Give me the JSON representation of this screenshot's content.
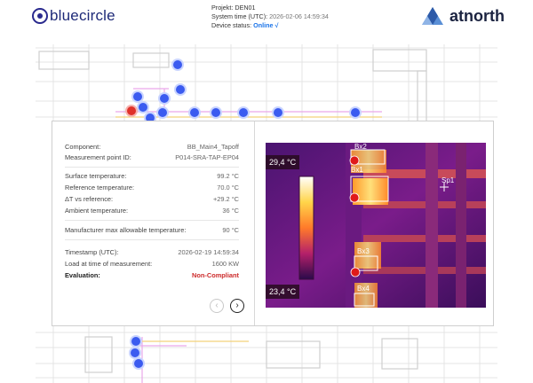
{
  "header": {
    "brand_left": "bluecircle",
    "project_label": "Projekt:",
    "project_value": "DEN01",
    "system_time_label": "System time (UTC):",
    "system_time_value": "2026-02-06 14:59:34",
    "device_status_label": "Device status:",
    "device_status_value": "Online √",
    "brand_right": "atnorth"
  },
  "popup": {
    "rows": [
      {
        "label": "Component:",
        "value": "BB_Main4_Tapoff"
      },
      {
        "label": "Measurement point ID:",
        "value": "P014-SRA-TAP-EP04"
      },
      {
        "label": "Surface temperature:",
        "value": "99.2 °C"
      },
      {
        "label": "Reference temperature:",
        "value": "70.0 °C"
      },
      {
        "label": "ΔT vs reference:",
        "value": "+29.2 °C"
      },
      {
        "label": "Ambient temperature:",
        "value": "36 °C"
      },
      {
        "label": "Manufacturer max allowable temperature:",
        "value": "90 °C"
      },
      {
        "label": "Timestamp (UTC):",
        "value": "2026-02-19 14:59:34"
      },
      {
        "label": "Load at time of measurement:",
        "value": "1600 KW"
      },
      {
        "label": "Evaluation:",
        "value": "Non-Compliant"
      }
    ],
    "thermal": {
      "temp_max": "29,4 °C",
      "temp_min": "23,4 °C",
      "labels": [
        "Bx2",
        "Bx1",
        "Sp1",
        "Bx3",
        "Bx4"
      ]
    }
  },
  "colors": {
    "marker": "#3b5bf0",
    "marker_selected": "#e0312a",
    "online": "#1a73e8",
    "non_compliant": "#cc2a2a"
  },
  "icons": {
    "prev": "chevron-left-icon",
    "next": "chevron-right-icon"
  }
}
